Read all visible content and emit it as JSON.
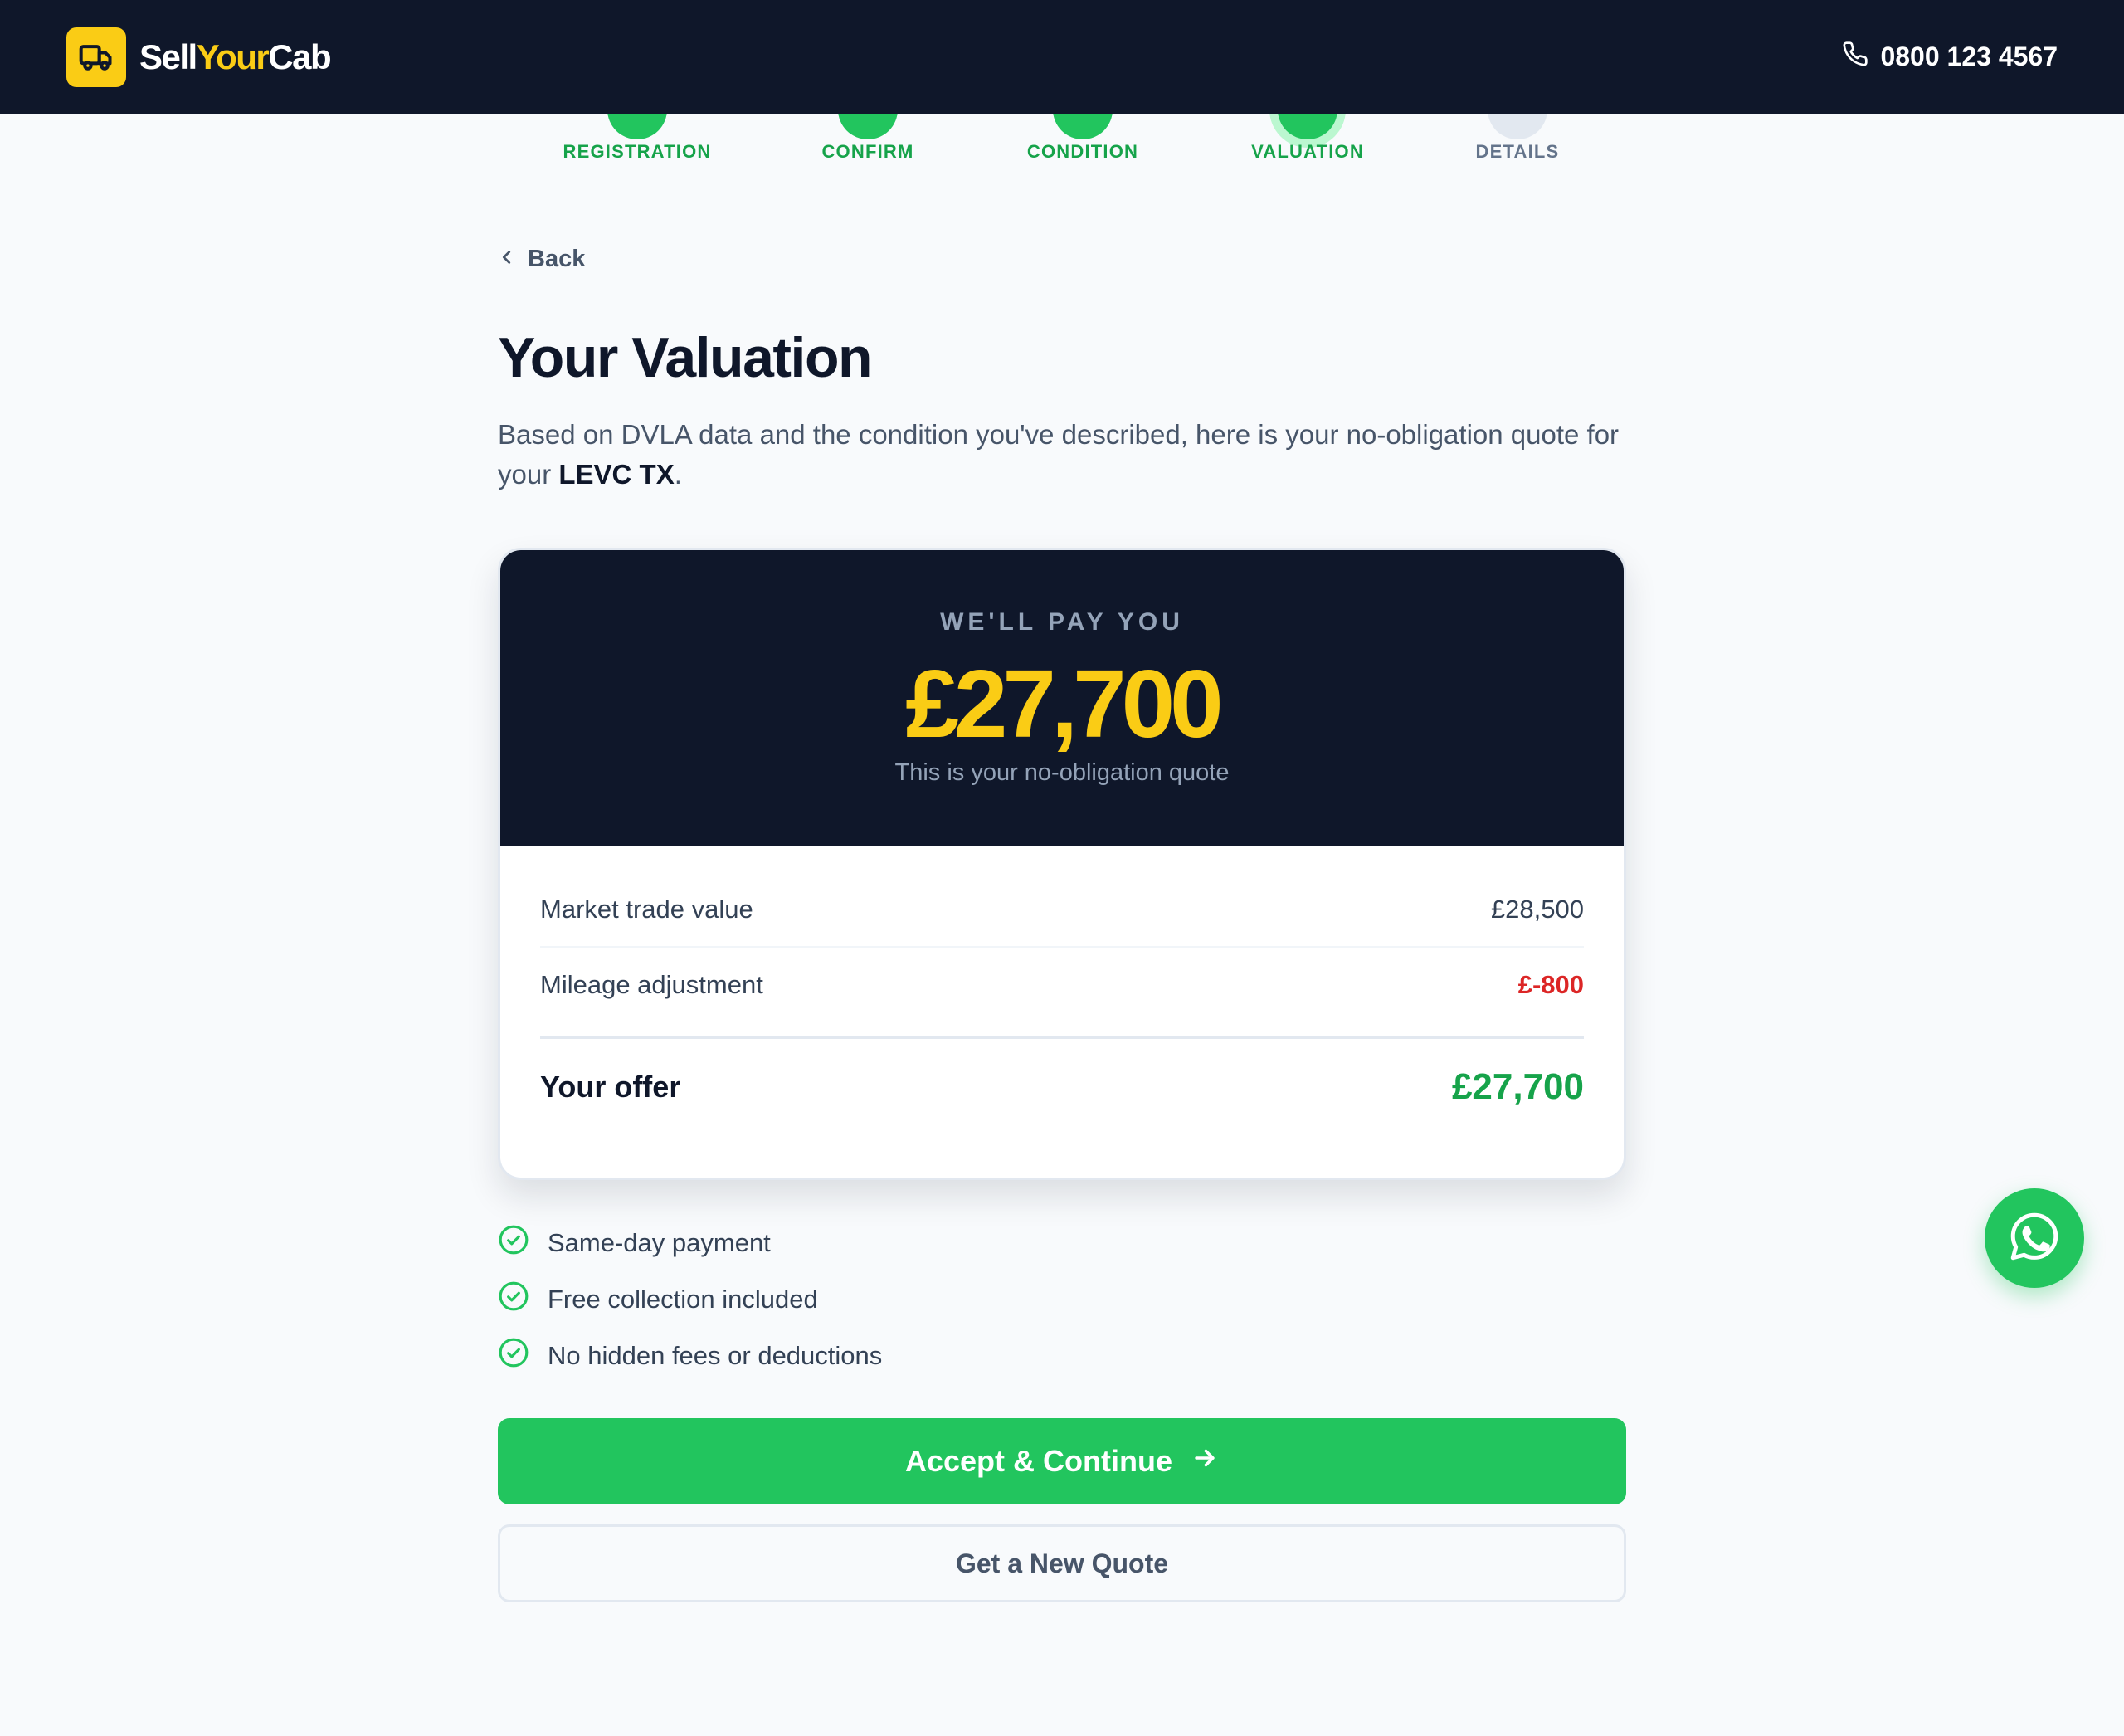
{
  "header": {
    "brand_part1": "Sell",
    "brand_part2": "Your",
    "brand_part3": "Cab",
    "logo_icon": "truck-icon",
    "phone_icon": "phone-icon",
    "phone": "0800 123 4567"
  },
  "stepper": {
    "steps": [
      {
        "label": "REGISTRATION",
        "state": "complete"
      },
      {
        "label": "CONFIRM",
        "state": "complete"
      },
      {
        "label": "CONDITION",
        "state": "complete"
      },
      {
        "label": "VALUATION",
        "state": "current"
      },
      {
        "label": "DETAILS",
        "state": "pending"
      }
    ]
  },
  "nav": {
    "back_label": "Back",
    "back_icon": "chevron-left-icon"
  },
  "page": {
    "title": "Your Valuation",
    "intro_text": "Based on DVLA data and the condition you've described, here is your no-obligation quote for your ",
    "vehicle": "LEVC TX",
    "intro_end": "."
  },
  "valuation": {
    "pay_label": "WE'LL PAY YOU",
    "amount": "£27,700",
    "subtitle": "This is your no-obligation quote",
    "rows": [
      {
        "label": "Market trade value",
        "value": "£28,500"
      },
      {
        "label": "Mileage adjustment",
        "value": "£-800"
      }
    ],
    "total_label": "Your offer",
    "total_value": "£27,700"
  },
  "benefits": [
    {
      "icon": "check-circle-icon",
      "label": "Same-day payment"
    },
    {
      "icon": "check-circle-icon",
      "label": "Free collection included"
    },
    {
      "icon": "check-circle-icon",
      "label": "No hidden fees or deductions"
    }
  ],
  "actions": {
    "accept_label": "Accept & Continue",
    "accept_icon": "arrow-right-icon",
    "new_quote_label": "Get a New Quote"
  },
  "fab": {
    "icon": "whatsapp-icon"
  },
  "colors": {
    "header_bg": "#0f172a",
    "brand_yellow": "#facc15",
    "success_green": "#22c55e",
    "negative_red": "#dc2626"
  }
}
